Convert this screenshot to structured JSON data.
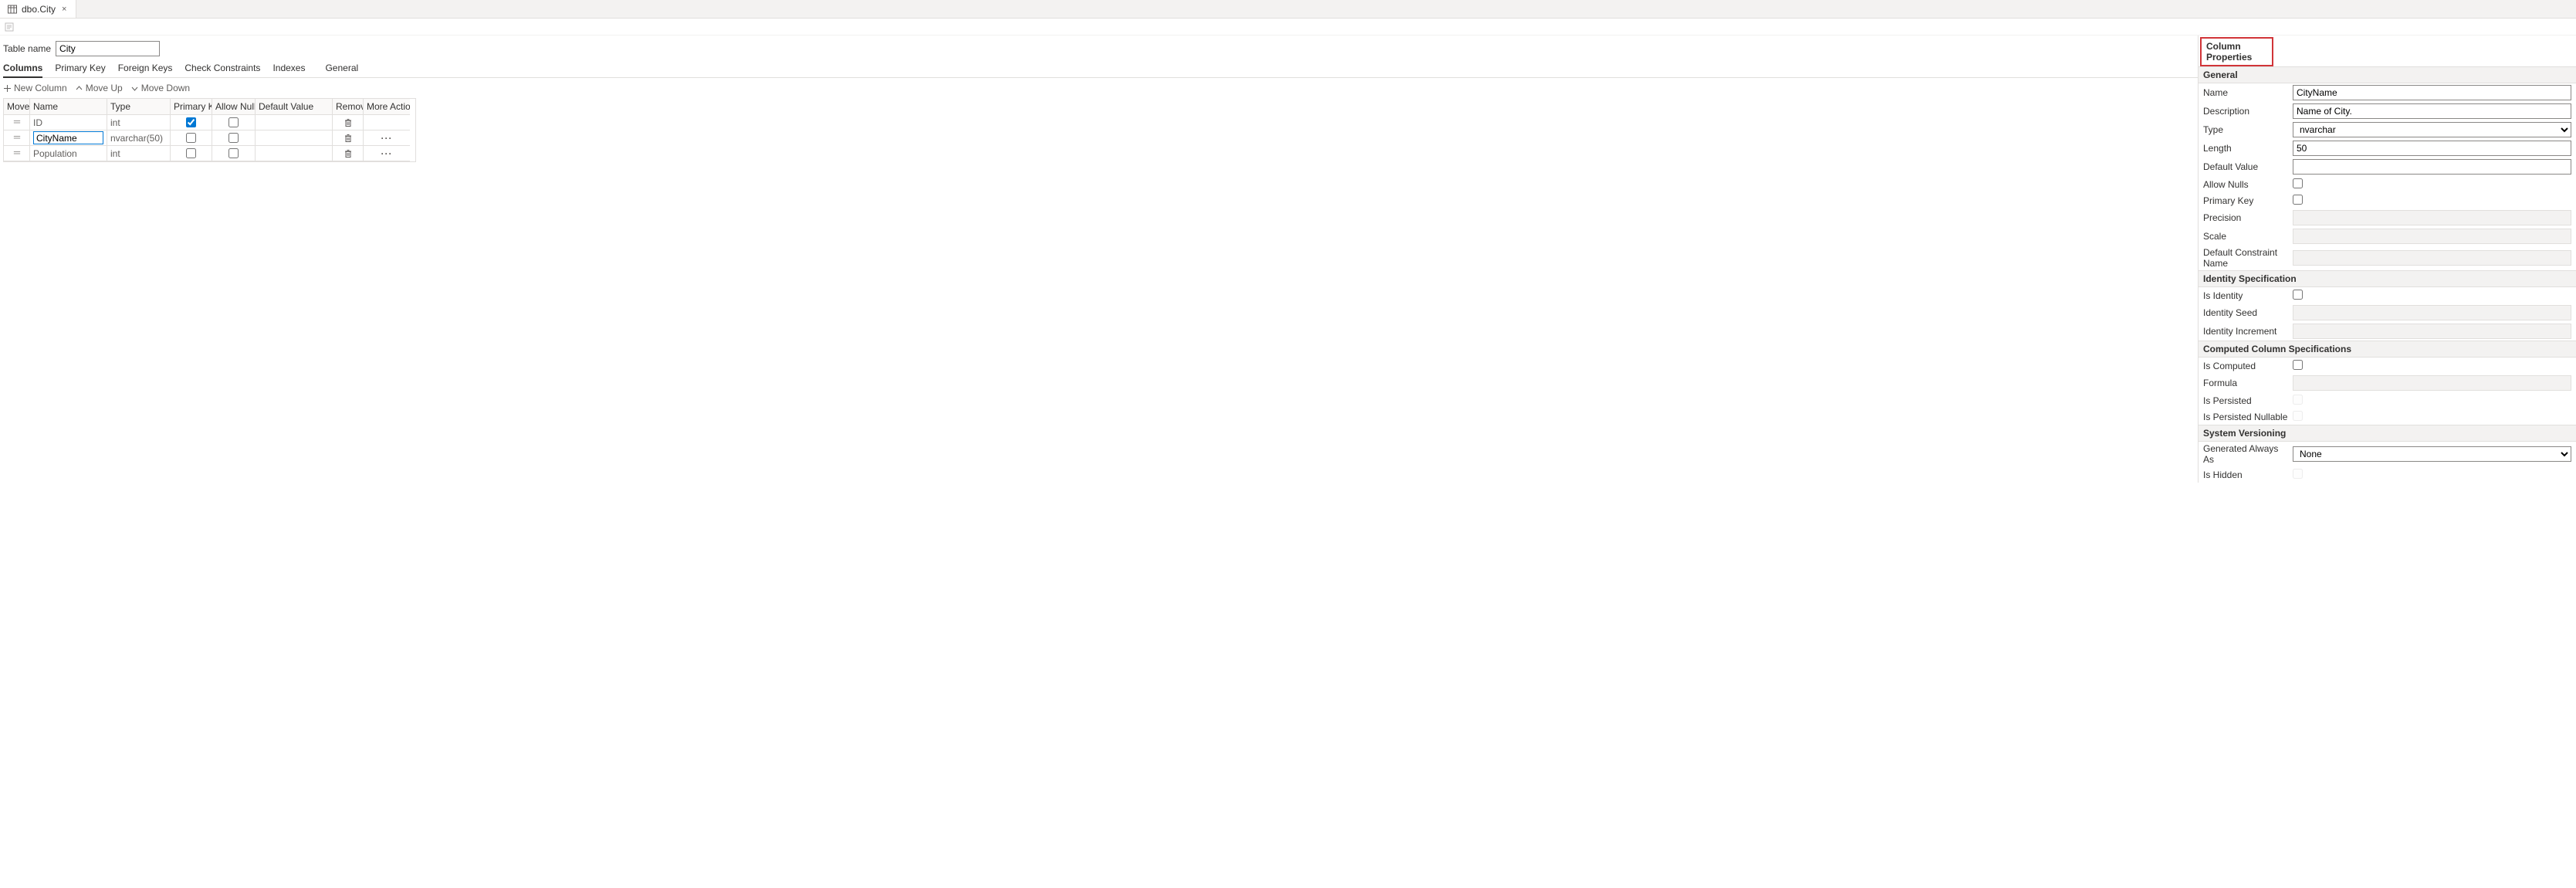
{
  "tab": {
    "title": "dbo.City",
    "close_label": "×"
  },
  "table_name_label": "Table name",
  "table_name_value": "City",
  "subtabs": [
    "Columns",
    "Primary Key",
    "Foreign Keys",
    "Check Constraints",
    "Indexes",
    "General"
  ],
  "active_subtab": 0,
  "col_toolbar": {
    "new_column": "New Column",
    "move_up": "Move Up",
    "move_down": "Move Down"
  },
  "grid": {
    "headers": [
      "Move",
      "Name",
      "Type",
      "Primary Key",
      "Allow Nulls",
      "Default Value",
      "Remove",
      "More Actions"
    ],
    "rows": [
      {
        "name": "ID",
        "type": "int",
        "primary_key": true,
        "allow_nulls": false,
        "editing": false,
        "has_more": false
      },
      {
        "name": "CityName",
        "type": "nvarchar(50)",
        "primary_key": false,
        "allow_nulls": false,
        "editing": true,
        "has_more": true
      },
      {
        "name": "Population",
        "type": "int",
        "primary_key": false,
        "allow_nulls": false,
        "editing": false,
        "has_more": true
      }
    ]
  },
  "panel": {
    "title": "Column Properties",
    "sections": {
      "general": {
        "label": "General",
        "name_label": "Name",
        "name_value": "CityName",
        "description_label": "Description",
        "description_value": "Name of City.",
        "type_label": "Type",
        "type_value": "nvarchar",
        "length_label": "Length",
        "length_value": "50",
        "default_value_label": "Default Value",
        "default_value_value": "",
        "allow_nulls_label": "Allow Nulls",
        "allow_nulls_value": false,
        "primary_key_label": "Primary Key",
        "primary_key_value": false,
        "precision_label": "Precision",
        "scale_label": "Scale",
        "default_constraint_label": "Default Constraint Name"
      },
      "identity": {
        "label": "Identity Specification",
        "is_identity_label": "Is Identity",
        "is_identity_value": false,
        "seed_label": "Identity Seed",
        "increment_label": "Identity Increment"
      },
      "computed": {
        "label": "Computed Column Specifications",
        "is_computed_label": "Is Computed",
        "is_computed_value": false,
        "formula_label": "Formula",
        "is_persisted_label": "Is Persisted",
        "is_persisted_nullable_label": "Is Persisted Nullable"
      },
      "versioning": {
        "label": "System Versioning",
        "generated_label": "Generated Always As",
        "generated_value": "None",
        "is_hidden_label": "Is Hidden"
      }
    }
  }
}
